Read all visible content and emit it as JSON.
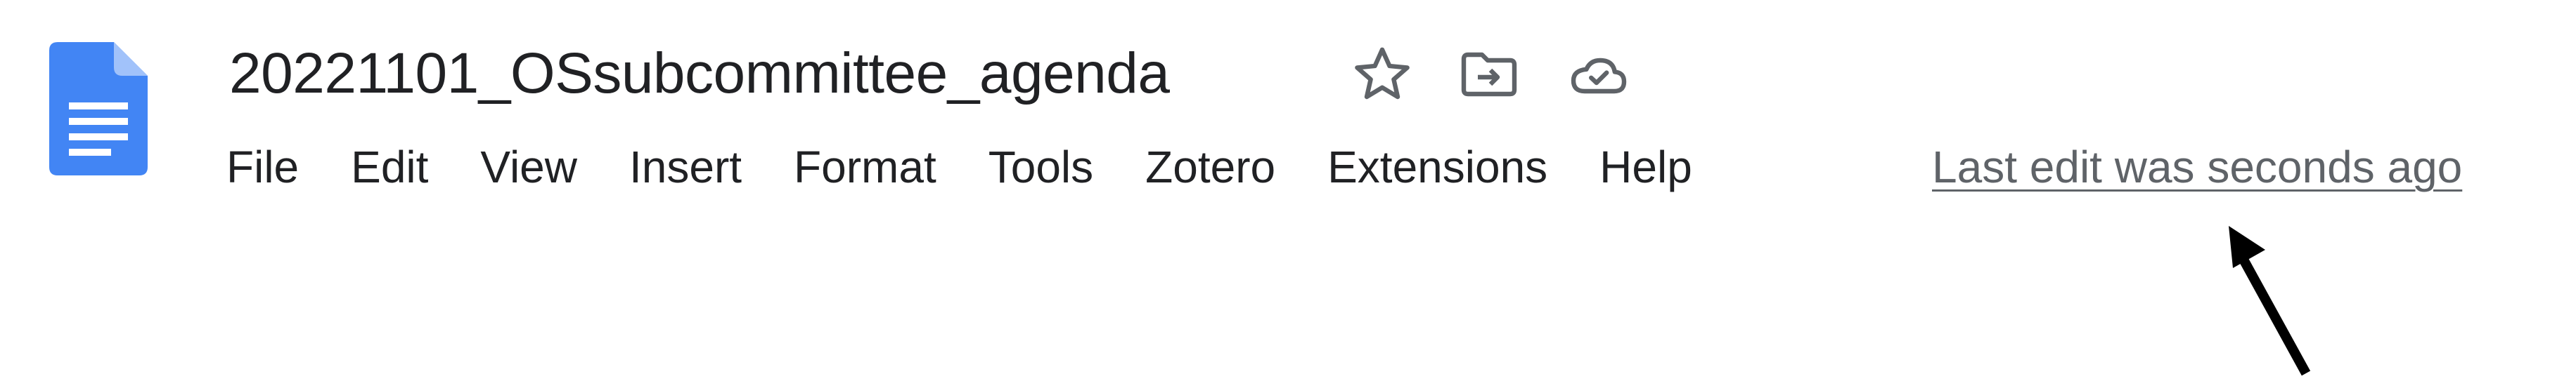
{
  "document": {
    "title": "20221101_OSsubcommittee_agenda",
    "last_edit": "Last edit was seconds ago"
  },
  "icons": {
    "logo": "google-docs-icon",
    "star": "star-icon",
    "move": "folder-move-icon",
    "status": "cloud-saved-icon"
  },
  "menu": {
    "items": [
      {
        "label": "File"
      },
      {
        "label": "Edit"
      },
      {
        "label": "View"
      },
      {
        "label": "Insert"
      },
      {
        "label": "Format"
      },
      {
        "label": "Tools"
      },
      {
        "label": "Zotero"
      },
      {
        "label": "Extensions"
      },
      {
        "label": "Help"
      }
    ]
  },
  "colors": {
    "docs_blue": "#4285F4",
    "docs_fold": "#A1C2FA",
    "text": "#202124",
    "muted_text": "#5f6368",
    "arrow": "#000000"
  }
}
